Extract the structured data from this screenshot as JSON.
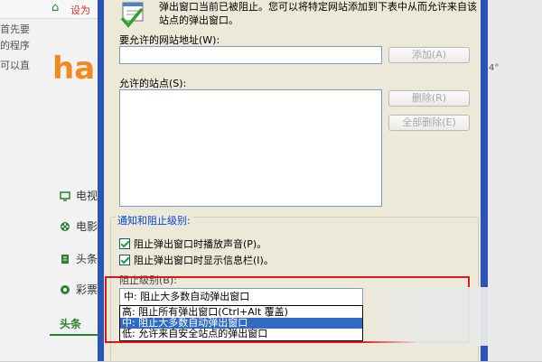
{
  "background_page": {
    "topbar_text": "设为",
    "side_lines": [
      "首先要",
      "的程序",
      "可以直"
    ],
    "logo_text": "ha",
    "categories": [
      "电视",
      "电影",
      "头条",
      "彩票"
    ],
    "toutiao": "头条",
    "right_fragment": "4°"
  },
  "dialog": {
    "info_text": "弹出窗口当前已被阻止。您可以将特定网站添加到下表中从而允许来自该站点的弹出窗口。",
    "site_address_label": "要允许的网站地址(W):",
    "site_address_value": "",
    "add_button": "添加(A)",
    "allowed_sites_label": "允许的站点(S):",
    "remove_button": "删除(R)",
    "remove_all_button": "全部删除(E)",
    "notify_group_title": "通知和阻止级别:",
    "checkbox_sound": "阻止弹出窗口时播放声音(P)。",
    "checkbox_infobar": "阻止弹出窗口时显示信息栏(I)。",
    "block_level_label": "阻止级别(B):",
    "block_level_selected": "中: 阻止大多数自动弹出窗口",
    "block_level_options": [
      "高: 阻止所有弹出窗口(Ctrl+Alt 覆盖)",
      "中: 阻止大多数自动弹出窗口",
      "低: 允许来自安全站点的弹出窗口"
    ]
  },
  "colors": {
    "highlight": "#316ac5",
    "red_annotation": "#e0151b",
    "group_title": "#0046d5",
    "window_frame": "#2b54b8"
  }
}
